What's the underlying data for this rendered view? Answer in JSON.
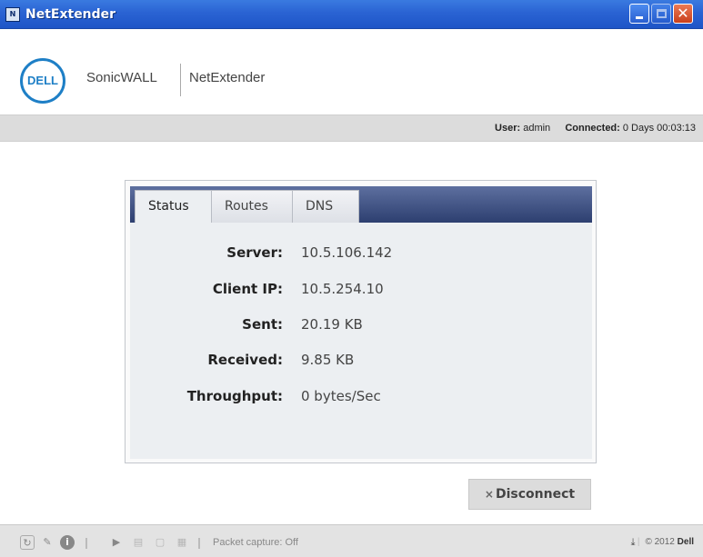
{
  "window": {
    "title": "NetExtender",
    "app_icon_text": "N"
  },
  "brand": {
    "logo_text": "DELL",
    "product_name": "SonicWALL",
    "app_name": "NetExtender"
  },
  "status_bar": {
    "user_label": "User:",
    "user_value": "admin",
    "connected_label": "Connected:",
    "connected_value": "0 Days 00:03:13"
  },
  "tabs": [
    {
      "label": "Status",
      "active": true
    },
    {
      "label": "Routes",
      "active": false
    },
    {
      "label": "DNS",
      "active": false
    }
  ],
  "status": [
    {
      "key": "Server:",
      "value": "10.5.106.142"
    },
    {
      "key": "Client IP:",
      "value": "10.5.254.10"
    },
    {
      "key": "Sent:",
      "value": "20.19 KB"
    },
    {
      "key": "Received:",
      "value": "9.85 KB"
    },
    {
      "key": "Throughput:",
      "value": "0 bytes/Sec"
    }
  ],
  "actions": {
    "disconnect_label": "Disconnect"
  },
  "toolbar": {
    "packet_capture": "Packet capture: Off",
    "copyright_prefix": "© 2012",
    "copyright_brand": "Dell"
  },
  "colors": {
    "titlebar": "#2a63d3",
    "tab_strip": "#2d3f70",
    "dell_blue": "#1e7fc6"
  }
}
